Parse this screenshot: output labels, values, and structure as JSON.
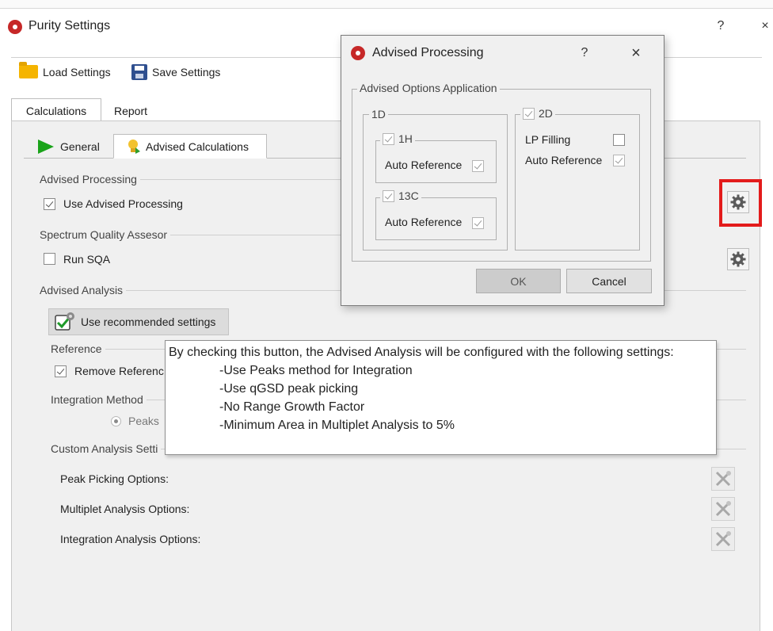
{
  "window": {
    "title": "Purity Settings",
    "help_glyph": "?",
    "close_glyph": "×"
  },
  "toolbar": {
    "load_label": "Load Settings",
    "save_label": "Save Settings",
    "load_icon": "folder-icon",
    "save_icon": "floppy-disk-icon"
  },
  "tabs": {
    "main": [
      "Calculations",
      "Report"
    ],
    "sub": [
      "General",
      "Advised Calculations"
    ],
    "active_main": "Calculations",
    "active_sub": "Advised Calculations"
  },
  "advised_processing": {
    "group_label": "Advised Processing",
    "checkbox_label": "Use Advised Processing",
    "checked": true
  },
  "sqa": {
    "group_label": "Spectrum Quality Assesor",
    "checkbox_label": "Run SQA",
    "checked": false
  },
  "advised_analysis": {
    "group_label": "Advised Analysis",
    "recommended_button": "Use recommended settings",
    "reference_label": "Reference",
    "remove_reference_label": "Remove Referenc",
    "remove_reference_checked": true,
    "integration_label": "Integration Method",
    "peaks_label": "Peaks",
    "custom_label": "Custom Analysis Setti",
    "options": [
      "Peak Picking Options:",
      "Multiplet Analysis Options:",
      "Integration Analysis Options:"
    ]
  },
  "tooltip": {
    "heading": "By checking this button, the Advised Analysis will be configured with the following settings:",
    "lines": [
      "-Use Peaks method for Integration",
      "-Use qGSD peak picking",
      "-No Range Growth Factor",
      "-Minimum Area in Multiplet Analysis to 5%"
    ]
  },
  "dialog": {
    "title": "Advised Processing",
    "help_glyph": "?",
    "close_glyph": "×",
    "group_label": "Advised Options Application",
    "oned_label": "1D",
    "h1_label": "1H",
    "c13_label": "13C",
    "auto_reference_label": "Auto Reference",
    "twod_label": "2D",
    "lp_filling_label": "LP Filling",
    "lp_filling_checked": false,
    "ok_label": "OK",
    "cancel_label": "Cancel"
  },
  "colors": {
    "highlight_border": "#e31b1b",
    "play_icon": "#1aa31a",
    "logo": "#c62828",
    "panel_bg": "#f0f0f0"
  }
}
